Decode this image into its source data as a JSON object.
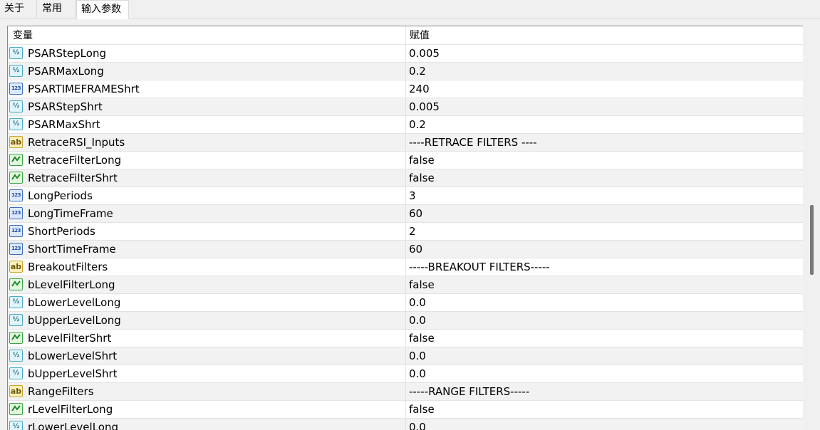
{
  "tabs": [
    {
      "label": "关于"
    },
    {
      "label": "常用"
    },
    {
      "label": "输入参数"
    }
  ],
  "table": {
    "columns": [
      "变量",
      "赋值"
    ],
    "rows": [
      {
        "type": "double",
        "icon": "double-icon",
        "name": "PSARStepLong",
        "value": "0.005"
      },
      {
        "type": "double",
        "icon": "double-icon",
        "name": "PSARMaxLong",
        "value": "0.2"
      },
      {
        "type": "integer",
        "icon": "integer-icon",
        "name": "PSARTIMEFRAMEShrt",
        "value": "240"
      },
      {
        "type": "double",
        "icon": "double-icon",
        "name": "PSARStepShrt",
        "value": "0.005"
      },
      {
        "type": "double",
        "icon": "double-icon",
        "name": "PSARMaxShrt",
        "value": "0.2"
      },
      {
        "type": "string",
        "icon": "string-icon",
        "name": "RetraceRSI_Inputs",
        "value": "----RETRACE FILTERS ----"
      },
      {
        "type": "bool",
        "icon": "bool-icon",
        "name": "RetraceFilterLong",
        "value": "false"
      },
      {
        "type": "bool",
        "icon": "bool-icon",
        "name": "RetraceFilterShrt",
        "value": "false"
      },
      {
        "type": "integer",
        "icon": "integer-icon",
        "name": "LongPeriods",
        "value": "3"
      },
      {
        "type": "integer",
        "icon": "integer-icon",
        "name": "LongTimeFrame",
        "value": "60"
      },
      {
        "type": "integer",
        "icon": "integer-icon",
        "name": "ShortPeriods",
        "value": "2"
      },
      {
        "type": "integer",
        "icon": "integer-icon",
        "name": "ShortTimeFrame",
        "value": "60"
      },
      {
        "type": "string",
        "icon": "string-icon",
        "name": "BreakoutFilters",
        "value": "-----BREAKOUT FILTERS-----"
      },
      {
        "type": "bool",
        "icon": "bool-icon",
        "name": "bLevelFilterLong",
        "value": "false"
      },
      {
        "type": "double",
        "icon": "double-icon",
        "name": "bLowerLevelLong",
        "value": "0.0"
      },
      {
        "type": "double",
        "icon": "double-icon",
        "name": "bUpperLevelLong",
        "value": "0.0"
      },
      {
        "type": "bool",
        "icon": "bool-icon",
        "name": "bLevelFilterShrt",
        "value": "false"
      },
      {
        "type": "double",
        "icon": "double-icon",
        "name": "bLowerLevelShrt",
        "value": "0.0"
      },
      {
        "type": "double",
        "icon": "double-icon",
        "name": "bUpperLevelShrt",
        "value": "0.0"
      },
      {
        "type": "string",
        "icon": "string-icon",
        "name": "RangeFilters",
        "value": "-----RANGE FILTERS-----"
      },
      {
        "type": "bool",
        "icon": "bool-icon",
        "name": "rLevelFilterLong",
        "value": "false"
      },
      {
        "type": "double",
        "icon": "double-icon",
        "name": "rLowerLevelLong",
        "value": "0.0"
      }
    ]
  }
}
